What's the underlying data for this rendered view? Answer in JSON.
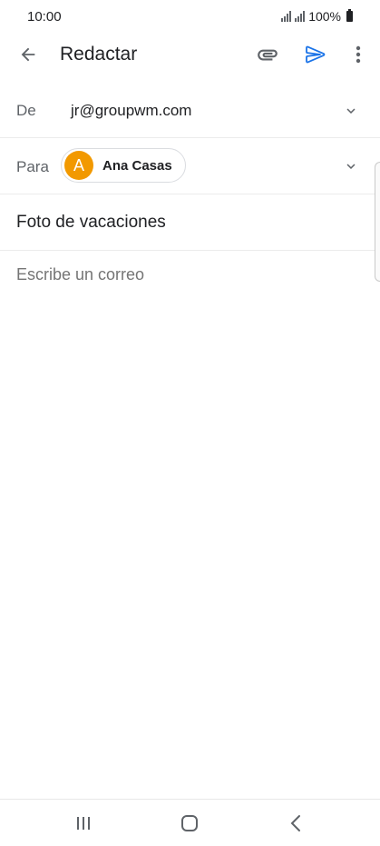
{
  "status": {
    "time": "10:00",
    "battery": "100%"
  },
  "toolbar": {
    "title": "Redactar"
  },
  "from": {
    "label": "De",
    "value": "jr@groupwm.com"
  },
  "to": {
    "label": "Para",
    "recipient": {
      "initial": "A",
      "name": "Ana Casas",
      "color": "#f29900"
    }
  },
  "subject": {
    "value": "Foto de vacaciones"
  },
  "compose": {
    "placeholder": "Escribe un correo"
  },
  "colors": {
    "accent": "#1a73e8",
    "icon": "#5f6368"
  },
  "icons": [
    "back-arrow-icon",
    "attach-icon",
    "send-icon",
    "more-vert-icon",
    "chevron-down-icon",
    "recents-icon",
    "home-icon",
    "back-icon"
  ]
}
